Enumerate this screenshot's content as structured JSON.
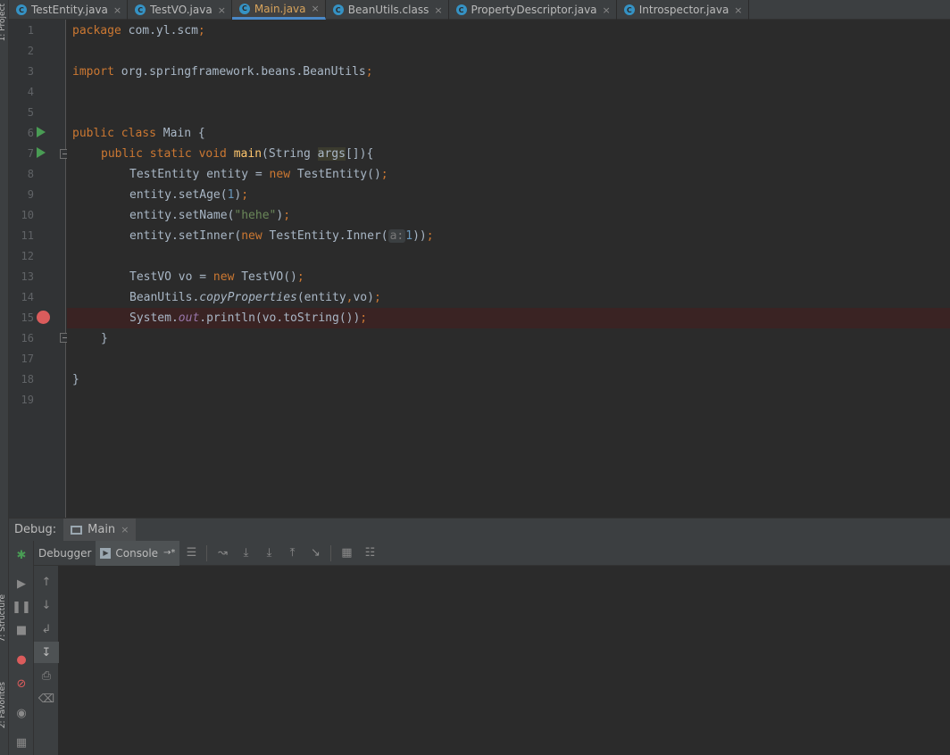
{
  "side_labels": {
    "project": "1: Project",
    "structure": "7: Structure",
    "favorites": "2: Favorites"
  },
  "tabs": [
    {
      "label": "TestEntity.java",
      "icon": "C",
      "active": false
    },
    {
      "label": "TestVO.java",
      "icon": "C",
      "active": false
    },
    {
      "label": "Main.java",
      "icon": "C",
      "active": true
    },
    {
      "label": "BeanUtils.class",
      "icon": "C",
      "active": false
    },
    {
      "label": "PropertyDescriptor.java",
      "icon": "C",
      "active": false
    },
    {
      "label": "Introspector.java",
      "icon": "C",
      "active": false
    }
  ],
  "tab_close": "×",
  "line_numbers": [
    "1",
    "2",
    "3",
    "4",
    "5",
    "6",
    "7",
    "8",
    "9",
    "10",
    "11",
    "12",
    "13",
    "14",
    "15",
    "16",
    "17",
    "18",
    "19"
  ],
  "code": {
    "l1_kw": "package",
    "l1_rest": " com.yl.scm",
    "l1_semi": ";",
    "l3_kw": "import",
    "l3_rest": " org.springframework.beans.BeanUtils",
    "l3_semi": ";",
    "l6_kw": "public class",
    "l6_rest": " Main {",
    "l7_kw": "public static void",
    "l7_method": "main",
    "l7_open": "(String ",
    "l7_args": "args",
    "l7_close": "[]){",
    "l8_a": "TestEntity entity = ",
    "l8_new": "new",
    "l8_b": " TestEntity()",
    "l8_semi": ";",
    "l9_a": "entity.setAge(",
    "l9_num": "1",
    "l9_b": ")",
    "l9_semi": ";",
    "l10_a": "entity.setName(",
    "l10_str": "\"hehe\"",
    "l10_b": ")",
    "l10_semi": ";",
    "l11_a": "entity.setInner(",
    "l11_new": "new",
    "l11_b": " TestEntity.Inner(",
    "l11_hint": "a:",
    "l11_num": "1",
    "l11_c": "))",
    "l11_semi": ";",
    "l13_a": "TestVO vo = ",
    "l13_new": "new",
    "l13_b": " TestVO()",
    "l13_semi": ";",
    "l14_a": "BeanUtils.",
    "l14_method": "copyProperties",
    "l14_b": "(entity",
    "l14_comma": ",",
    "l14_c": "vo)",
    "l14_semi": ";",
    "l15_a": "System.",
    "l15_out": "out",
    "l15_b": ".println(vo.toString())",
    "l15_semi": ";",
    "l16": "}",
    "l18": "}"
  },
  "debug": {
    "title": "Debug:",
    "session_tab": "Main",
    "session_close": "×",
    "debugger_tab": "Debugger",
    "console_tab": "Console",
    "console_arrow": "→*"
  },
  "colors": {
    "keyword": "#cc7832",
    "number": "#6897bb",
    "string": "#6a8759",
    "method": "#ffc66d",
    "static_field": "#9876aa",
    "breakpoint": "#db5c5c",
    "run": "#499c54",
    "active_tab": "#d7a35c"
  }
}
